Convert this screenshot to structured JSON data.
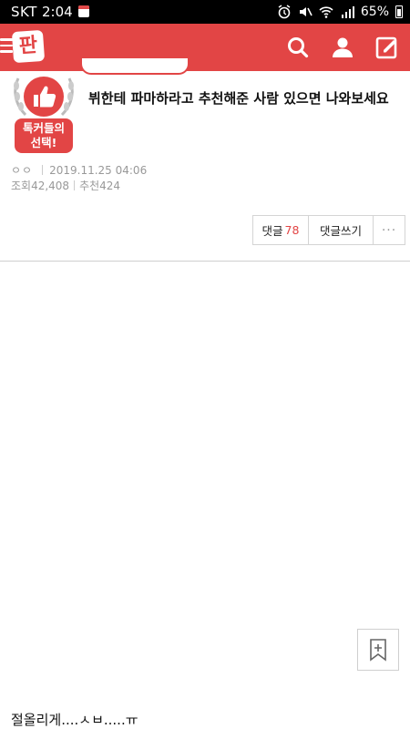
{
  "status_bar": {
    "carrier": "SKT",
    "time": "2:04",
    "battery": "65%"
  },
  "header": {
    "logo": "판",
    "icons": [
      "menu-icon",
      "search-icon",
      "user-icon",
      "write-icon"
    ]
  },
  "post": {
    "badge_line1": "톡커들의",
    "badge_line2": "선택!",
    "title": "뷔한테 파마하라고 추천해준 사람 있으면 나와보세요",
    "author": "ㅇㅇ",
    "date": "2019.11.25 04:06",
    "views": "조회42,408",
    "recommends": "추천424",
    "body_text": "절올리게....ㅅㅂ.....ㅠ"
  },
  "actions": {
    "comments_label": "댓글",
    "comments_count": "78",
    "write_comment_label": "댓글쓰기",
    "more_label": "···"
  },
  "colors": {
    "brand": "#e24545",
    "meta_text": "#999999"
  }
}
